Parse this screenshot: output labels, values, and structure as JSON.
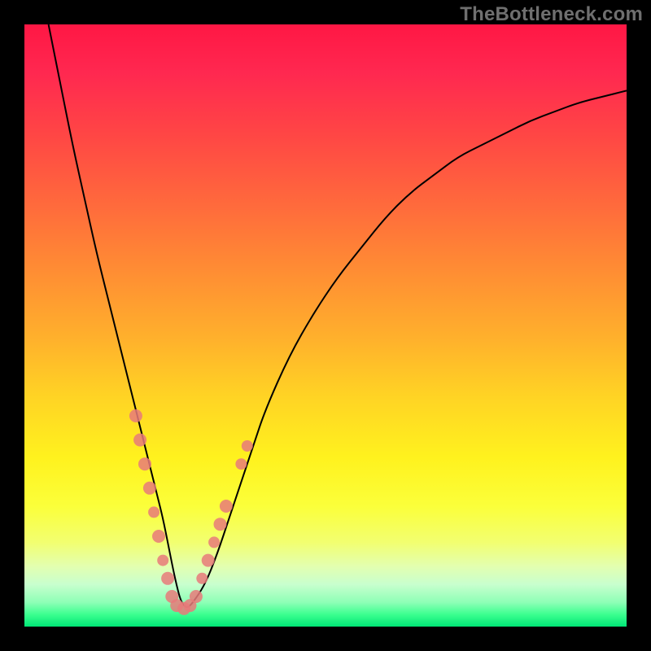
{
  "attribution": "TheBottleneck.com",
  "colors": {
    "gradient_top": "#ff1744",
    "gradient_bottom": "#00e676",
    "curve": "#000000",
    "marker": "#e87a7a",
    "frame": "#000000"
  },
  "chart_data": {
    "type": "line",
    "title": "",
    "xlabel": "",
    "ylabel": "",
    "xlim": [
      0,
      100
    ],
    "ylim": [
      0,
      100
    ],
    "grid": false,
    "x": [
      4,
      6,
      8,
      10,
      12,
      14,
      16,
      18,
      20,
      21,
      22,
      23,
      24,
      25,
      26,
      27,
      28,
      30,
      32,
      34,
      36,
      38,
      40,
      44,
      48,
      52,
      56,
      60,
      64,
      68,
      72,
      76,
      80,
      84,
      88,
      92,
      96,
      100
    ],
    "y": [
      100,
      90,
      80,
      71,
      62,
      54,
      46,
      38,
      30,
      26,
      22,
      18,
      13,
      8,
      4,
      3,
      4,
      7,
      12,
      18,
      24,
      30,
      36,
      45,
      52,
      58,
      63,
      68,
      72,
      75,
      78,
      80,
      82,
      84,
      85.5,
      87,
      88,
      89
    ],
    "markers": [
      {
        "x": 18.5,
        "y": 35,
        "r": 8
      },
      {
        "x": 19.2,
        "y": 31,
        "r": 8
      },
      {
        "x": 20.0,
        "y": 27,
        "r": 8
      },
      {
        "x": 20.8,
        "y": 23,
        "r": 8
      },
      {
        "x": 21.5,
        "y": 19,
        "r": 7
      },
      {
        "x": 22.3,
        "y": 15,
        "r": 8
      },
      {
        "x": 23.0,
        "y": 11,
        "r": 7
      },
      {
        "x": 23.8,
        "y": 8,
        "r": 8
      },
      {
        "x": 24.5,
        "y": 5,
        "r": 8
      },
      {
        "x": 25.3,
        "y": 3.5,
        "r": 8
      },
      {
        "x": 26.5,
        "y": 3,
        "r": 8
      },
      {
        "x": 27.5,
        "y": 3.5,
        "r": 8
      },
      {
        "x": 28.5,
        "y": 5,
        "r": 8
      },
      {
        "x": 29.5,
        "y": 8,
        "r": 7
      },
      {
        "x": 30.5,
        "y": 11,
        "r": 8
      },
      {
        "x": 31.5,
        "y": 14,
        "r": 7
      },
      {
        "x": 32.5,
        "y": 17,
        "r": 8
      },
      {
        "x": 33.5,
        "y": 20,
        "r": 8
      },
      {
        "x": 36.0,
        "y": 27,
        "r": 7
      },
      {
        "x": 37.0,
        "y": 30,
        "r": 7
      }
    ]
  }
}
